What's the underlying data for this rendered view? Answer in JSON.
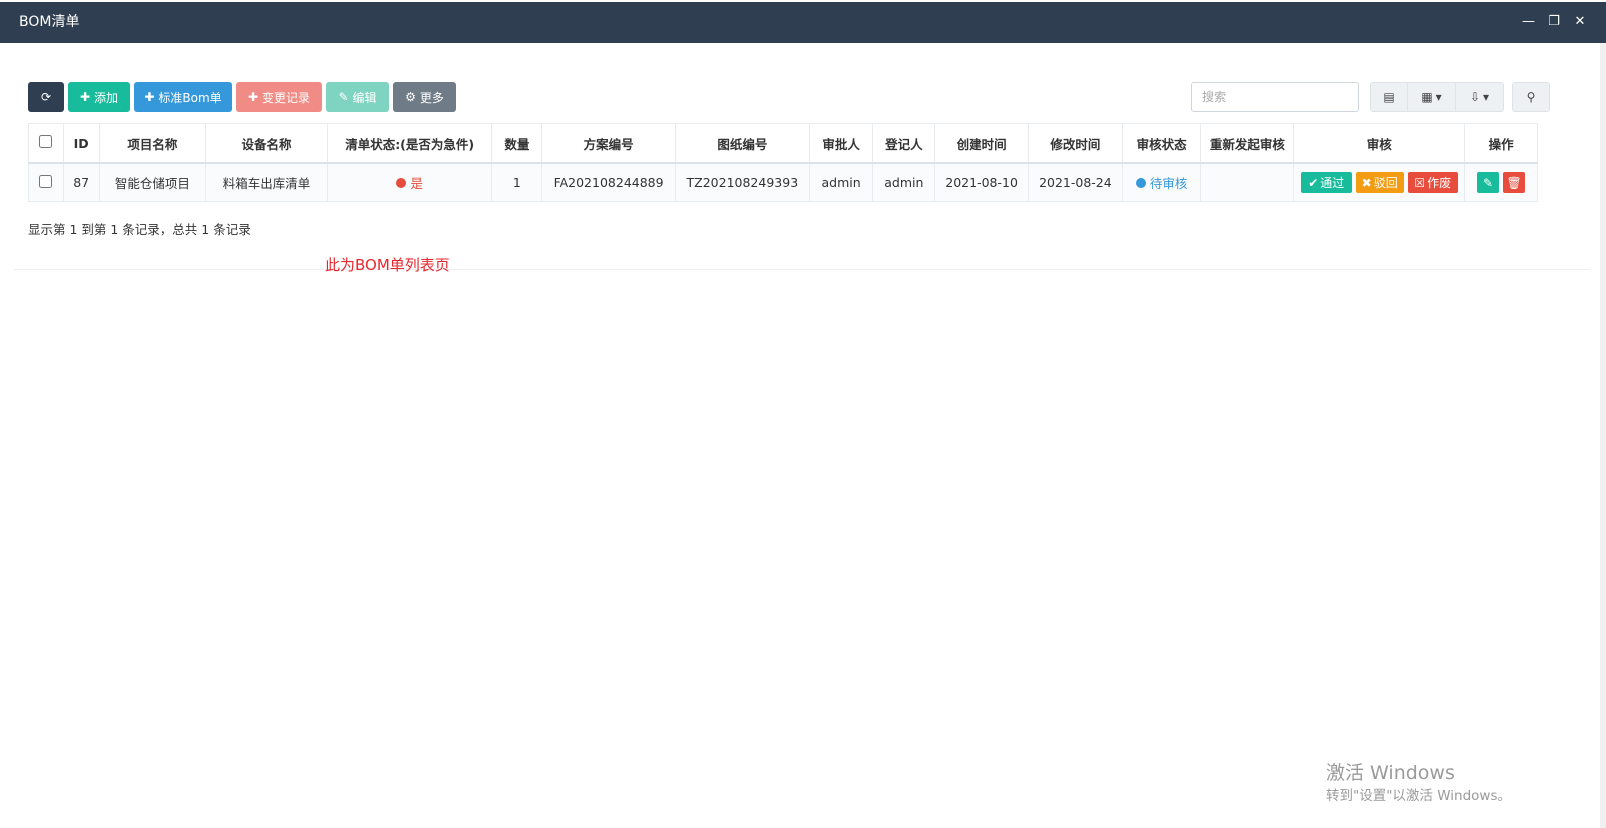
{
  "window": {
    "title": "BOM清单",
    "minimize": "—",
    "restore": "❐",
    "close": "✕"
  },
  "toolbar": {
    "refresh_icon": "⟳",
    "add": {
      "icon": "✚",
      "label": "添加"
    },
    "standard_bom": {
      "icon": "✚",
      "label": "标准Bom单"
    },
    "change_log": {
      "icon": "✚",
      "label": "变更记录"
    },
    "edit": {
      "icon": "✎",
      "label": "编辑"
    },
    "more": {
      "icon": "⚙",
      "label": "更多"
    }
  },
  "search": {
    "placeholder": "搜索",
    "value": ""
  },
  "tools": {
    "table_view_icon": "▤",
    "columns_icon": "▦",
    "export_icon": "⇩",
    "caret": "▾",
    "search_icon": "⚲"
  },
  "table": {
    "headers": [
      "ID",
      "项目名称",
      "设备名称",
      "清单状态:(是否为急件)",
      "数量",
      "方案编号",
      "图纸编号",
      "审批人",
      "登记人",
      "创建时间",
      "修改时间",
      "审核状态",
      "重新发起审核",
      "审核",
      "操作"
    ],
    "rows": [
      {
        "id": "87",
        "project": "智能仓储项目",
        "device": "料箱车出库清单",
        "urgent": "是",
        "quantity": "1",
        "plan_no": "FA202108244889",
        "drawing_no": "TZ202108249393",
        "approver": "admin",
        "registrant": "admin",
        "created": "2021-08-10",
        "modified": "2021-08-24",
        "review_status": "待审核",
        "resubmit": "",
        "actions": {
          "pass": {
            "icon": "✔",
            "label": "通过"
          },
          "reject": {
            "icon": "✖",
            "label": "驳回"
          },
          "void": {
            "icon": "☒",
            "label": "作废"
          },
          "edit_icon": "✎",
          "delete_icon": "🗑"
        }
      }
    ]
  },
  "pagination": {
    "info": "显示第 1 到第 1 条记录，总共 1 条记录"
  },
  "note": "此为BOM单列表页",
  "watermark": {
    "title": "激活 Windows",
    "subtitle": "转到\"设置\"以激活 Windows。"
  },
  "colors": {
    "titlebar": "#2f3e50",
    "success": "#18bc9c",
    "primary": "#3498db",
    "danger": "#e74c3c",
    "warning": "#f39c12",
    "urgent_dot": "#e74c3c",
    "pending_dot": "#3498db"
  }
}
